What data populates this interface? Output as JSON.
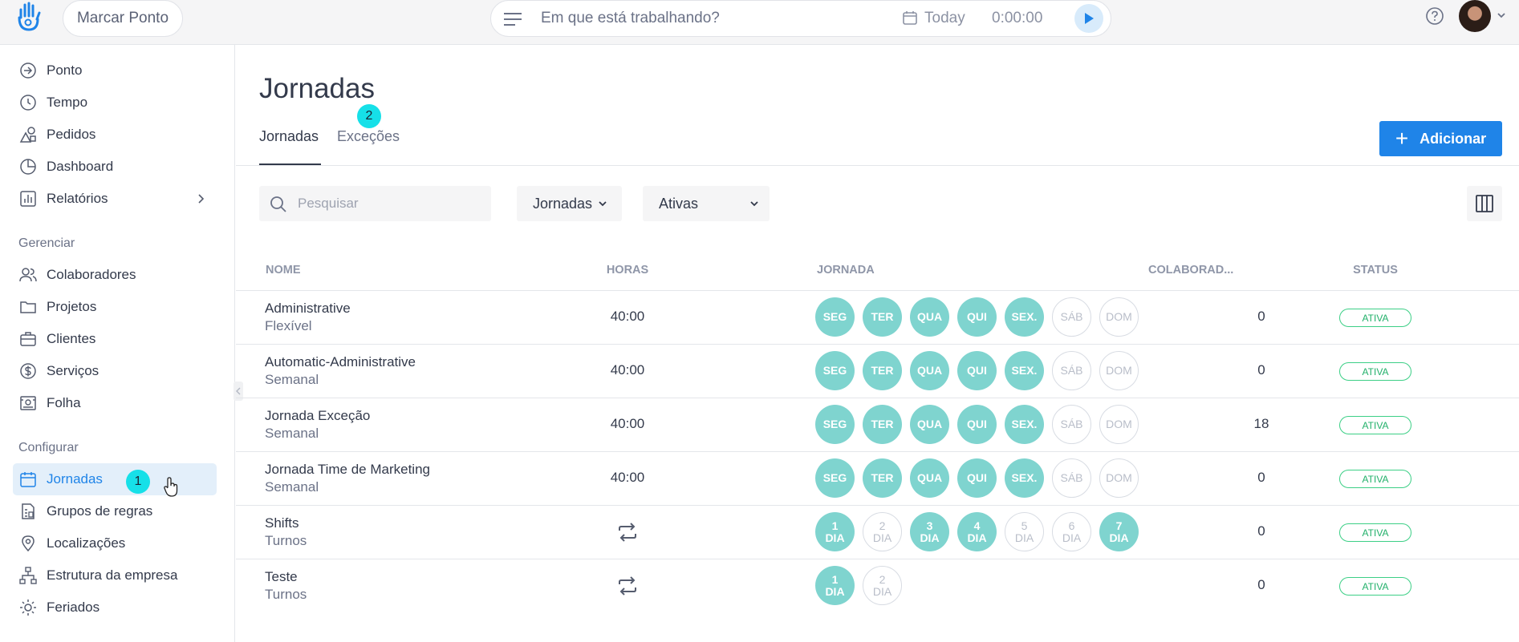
{
  "topbar": {
    "marcar_label": "Marcar Ponto",
    "timer_placeholder": "Em que está trabalhando?",
    "today_label": "Today",
    "time_value": "0:00:00"
  },
  "sidebar": {
    "items": [
      {
        "label": "Ponto"
      },
      {
        "label": "Tempo"
      },
      {
        "label": "Pedidos"
      },
      {
        "label": "Dashboard"
      },
      {
        "label": "Relatórios"
      }
    ],
    "section_manage": "Gerenciar",
    "manage_items": [
      {
        "label": "Colaboradores"
      },
      {
        "label": "Projetos"
      },
      {
        "label": "Clientes"
      },
      {
        "label": "Serviços"
      },
      {
        "label": "Folha"
      }
    ],
    "section_config": "Configurar",
    "config_items": [
      {
        "label": "Jornadas"
      },
      {
        "label": "Grupos de regras"
      },
      {
        "label": "Localizações"
      },
      {
        "label": "Estrutura da empresa"
      },
      {
        "label": "Feriados"
      }
    ]
  },
  "badges": {
    "one": "1",
    "two": "2"
  },
  "main": {
    "title": "Jornadas",
    "tabs": [
      "Jornadas",
      "Exceções"
    ],
    "add_label": "Adicionar",
    "search_placeholder": "Pesquisar",
    "filter_type": "Jornadas",
    "filter_status": "Ativas",
    "columns": [
      "NOME",
      "HORAS",
      "JORNADA",
      "COLABORAD...",
      "STATUS"
    ],
    "rows": [
      {
        "name": "Administrative",
        "type": "Flexível",
        "hours": "40:00",
        "count": "0",
        "status": "ATIVA"
      },
      {
        "name": "Automatic-Administrative",
        "type": "Semanal",
        "hours": "40:00",
        "count": "0",
        "status": "ATIVA"
      },
      {
        "name": "Jornada Exceção",
        "type": "Semanal",
        "hours": "40:00",
        "count": "18",
        "status": "ATIVA"
      },
      {
        "name": "Jornada Time de Marketing",
        "type": "Semanal",
        "hours": "40:00",
        "count": "0",
        "status": "ATIVA"
      },
      {
        "name": "Shifts",
        "type": "Turnos",
        "hours": "",
        "count": "0",
        "status": "ATIVA"
      },
      {
        "name": "Teste",
        "type": "Turnos",
        "hours": "",
        "count": "0",
        "status": "ATIVA"
      }
    ],
    "week_days": [
      "SEG",
      "TER",
      "QUA",
      "QUI",
      "SEX.",
      "SÁB",
      "DOM"
    ],
    "shift_days_7": [
      "1 DIA",
      "2 DIA",
      "3 DIA",
      "4 DIA",
      "5 DIA",
      "6 DIA",
      "7 DIA"
    ],
    "shift_days_2": [
      "1 DIA",
      "2 DIA"
    ]
  },
  "colors": {
    "accent": "#1f84e8",
    "day_on": "#7fd4cf",
    "status": "#22b06a",
    "badge": "#16e0e8"
  }
}
